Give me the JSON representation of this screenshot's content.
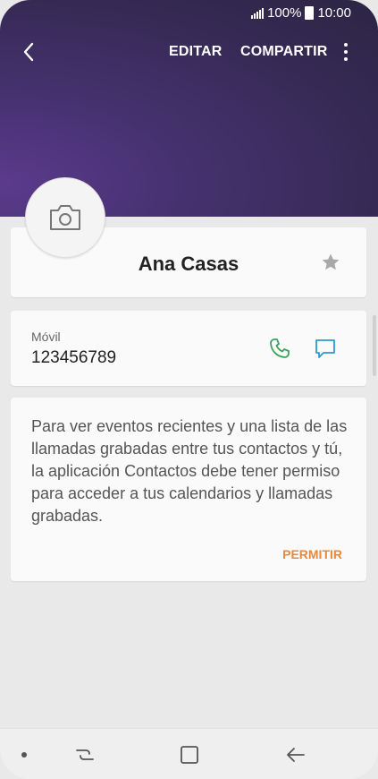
{
  "status_bar": {
    "battery": "100%",
    "time": "10:00"
  },
  "toolbar": {
    "edit_label": "EDITAR",
    "share_label": "COMPARTIR"
  },
  "contact": {
    "name": "Ana Casas",
    "phone_label": "Móvil",
    "phone_number": "123456789"
  },
  "permission_card": {
    "message": "Para ver eventos recientes y una lista de las llamadas grabadas entre tus contactos y tú, la aplicación Contactos debe tener permiso para acceder a tus calendarios y llamadas grabadas.",
    "allow_label": "PERMITIR"
  },
  "icons": {
    "back": "back-arrow-icon",
    "more": "more-vert-icon",
    "camera": "camera-icon",
    "star": "star-icon",
    "call": "call-icon",
    "message": "message-icon"
  },
  "colors": {
    "header_start": "#5b3a8d",
    "header_end": "#2c2543",
    "call_green": "#3aa35a",
    "message_blue": "#2a9dd0",
    "accent_orange": "#e8883a"
  }
}
